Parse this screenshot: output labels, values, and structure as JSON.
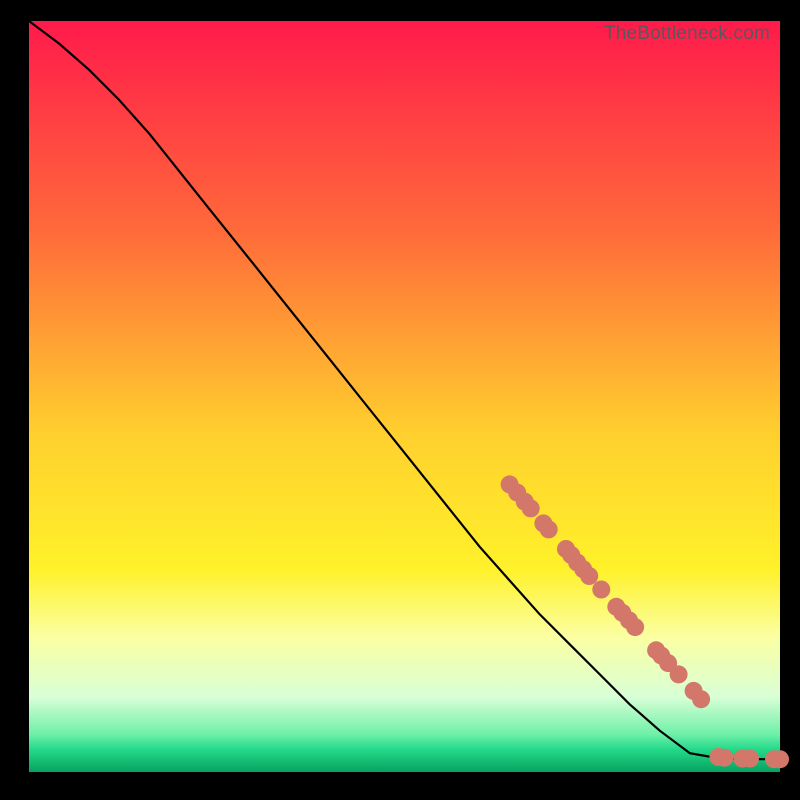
{
  "attribution": "TheBottleneck.com",
  "chart_data": {
    "type": "line",
    "title": "",
    "xlabel": "",
    "ylabel": "",
    "xlim": [
      0,
      100
    ],
    "ylim": [
      0,
      100
    ],
    "gradient_stops": [
      {
        "pct": 0,
        "color": "#ff1a4b"
      },
      {
        "pct": 28,
        "color": "#ff6a3a"
      },
      {
        "pct": 55,
        "color": "#ffd02e"
      },
      {
        "pct": 73,
        "color": "#fff12a"
      },
      {
        "pct": 82,
        "color": "#fbffa2"
      },
      {
        "pct": 90,
        "color": "#d8ffd6"
      },
      {
        "pct": 95,
        "color": "#6ef0a8"
      },
      {
        "pct": 97,
        "color": "#24d98a"
      },
      {
        "pct": 100,
        "color": "#07a25f"
      }
    ],
    "series": [
      {
        "name": "bottleneck-curve",
        "x": [
          0,
          4,
          8,
          12,
          16,
          20,
          24,
          28,
          32,
          36,
          40,
          44,
          48,
          52,
          56,
          60,
          64,
          68,
          72,
          76,
          80,
          84,
          88,
          92,
          96,
          100
        ],
        "y": [
          100,
          97,
          93.5,
          89.5,
          85,
          80,
          75,
          70,
          65,
          60,
          55,
          50,
          45,
          40,
          35,
          30,
          25.5,
          21,
          17,
          13,
          9,
          5.5,
          2.5,
          1.8,
          1.7,
          1.7
        ]
      }
    ],
    "markers": [
      {
        "x": 64.0,
        "y": 38.3
      },
      {
        "x": 65.0,
        "y": 37.2
      },
      {
        "x": 66.0,
        "y": 36.0
      },
      {
        "x": 66.8,
        "y": 35.1
      },
      {
        "x": 68.5,
        "y": 33.1
      },
      {
        "x": 69.2,
        "y": 32.3
      },
      {
        "x": 71.5,
        "y": 29.7
      },
      {
        "x": 72.2,
        "y": 28.9
      },
      {
        "x": 73.0,
        "y": 27.9
      },
      {
        "x": 73.8,
        "y": 27.0
      },
      {
        "x": 74.6,
        "y": 26.1
      },
      {
        "x": 76.2,
        "y": 24.3
      },
      {
        "x": 78.2,
        "y": 22.0
      },
      {
        "x": 79.0,
        "y": 21.2
      },
      {
        "x": 79.9,
        "y": 20.2
      },
      {
        "x": 80.7,
        "y": 19.3
      },
      {
        "x": 83.5,
        "y": 16.2
      },
      {
        "x": 84.2,
        "y": 15.5
      },
      {
        "x": 85.1,
        "y": 14.5
      },
      {
        "x": 86.5,
        "y": 13.0
      },
      {
        "x": 88.5,
        "y": 10.8
      },
      {
        "x": 89.5,
        "y": 9.7
      },
      {
        "x": 91.8,
        "y": 2.0
      },
      {
        "x": 92.6,
        "y": 1.9
      },
      {
        "x": 95.0,
        "y": 1.8
      },
      {
        "x": 96.0,
        "y": 1.8
      },
      {
        "x": 99.2,
        "y": 1.7
      },
      {
        "x": 100.0,
        "y": 1.7
      }
    ],
    "marker_style": {
      "color": "#d3776b",
      "radius_px": 9
    }
  }
}
